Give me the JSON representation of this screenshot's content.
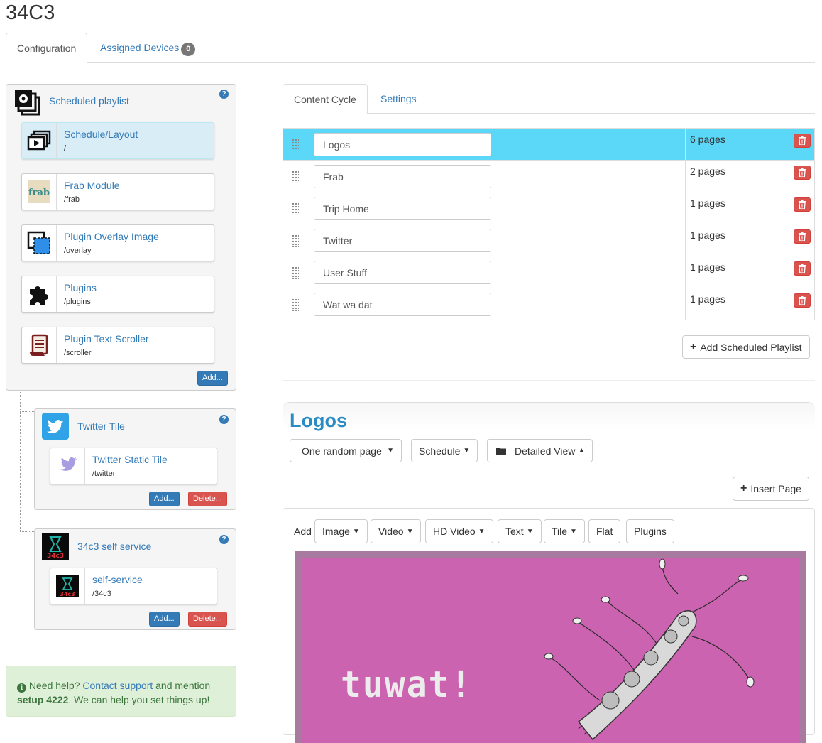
{
  "page": {
    "title": "34C3"
  },
  "top_tabs": {
    "configuration": "Configuration",
    "assigned_devices": "Assigned Devices",
    "assigned_count": "0"
  },
  "scheduled_playlist": {
    "title": "Scheduled playlist",
    "help": "?",
    "add_label": "Add...",
    "modules": [
      {
        "name": "Schedule/Layout",
        "path": "/",
        "icon": "layout-play-icon",
        "selected": true
      },
      {
        "name": "Frab Module",
        "path": "/frab",
        "icon": "frab-logo-icon"
      },
      {
        "name": "Plugin Overlay Image",
        "path": "/overlay",
        "icon": "overlay-image-icon"
      },
      {
        "name": "Plugins",
        "path": "/plugins",
        "icon": "puzzle-icon"
      },
      {
        "name": "Plugin Text Scroller",
        "path": "/scroller",
        "icon": "scroll-icon"
      }
    ]
  },
  "twitter_tile": {
    "title": "Twitter Tile",
    "help": "?",
    "module": {
      "name": "Twitter Static Tile",
      "path": "/twitter"
    },
    "add_label": "Add...",
    "delete_label": "Delete..."
  },
  "self_service": {
    "title": "34c3 self service",
    "help": "?",
    "module": {
      "name": "self-service",
      "path": "/34c3"
    },
    "add_label": "Add...",
    "delete_label": "Delete..."
  },
  "help_box": {
    "prefix": "Need help?",
    "link": "Contact support",
    "middle": "and mention",
    "setup": "setup 4222",
    "suffix": ". We can help you set things up!"
  },
  "content_tabs": {
    "cycle": "Content Cycle",
    "settings": "Settings"
  },
  "cycle_rows": [
    {
      "name": "Logos",
      "pages": "6 pages",
      "active": true
    },
    {
      "name": "Frab",
      "pages": "2 pages"
    },
    {
      "name": "Trip Home",
      "pages": "1 pages"
    },
    {
      "name": "Twitter",
      "pages": "1 pages"
    },
    {
      "name": "User Stuff",
      "pages": "1 pages"
    },
    {
      "name": "Wat wa dat",
      "pages": "1 pages"
    }
  ],
  "add_scheduled_playlist": "Add Scheduled Playlist",
  "logos_section": {
    "title": "Logos",
    "mode_select": "One random page",
    "schedule_btn": "Schedule",
    "view_btn": "Detailed View"
  },
  "insert_page": "Insert Page",
  "add_bar": {
    "label": "Add",
    "buttons": {
      "image": "Image",
      "video": "Video",
      "hdvideo": "HD Video",
      "text": "Text",
      "tile": "Tile",
      "flat": "Flat",
      "plugins": "Plugins"
    }
  },
  "preview": {
    "logo_text": "tuwat!"
  },
  "colors": {
    "link": "#337ab7",
    "active_row": "#5bd7f7",
    "danger": "#d9534f",
    "preview_bg": "#cb63b0",
    "help_bg": "#dff0d8"
  }
}
